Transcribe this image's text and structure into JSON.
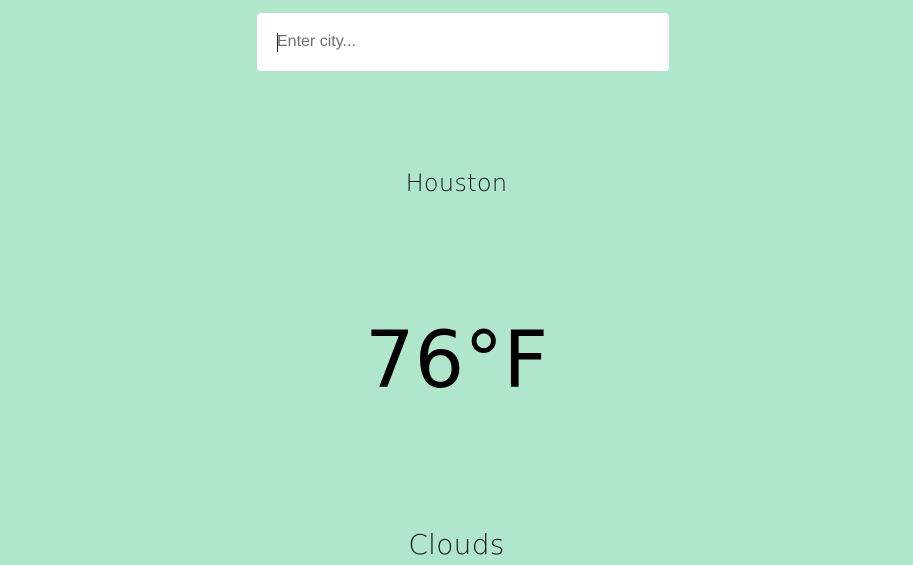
{
  "search": {
    "placeholder": "Enter city...",
    "value": ""
  },
  "weather": {
    "city": "Houston",
    "temperature": "76°F",
    "condition": "Clouds"
  },
  "colors": {
    "background": "#b0e6cb",
    "input_background": "#ffffff",
    "text": "#111111"
  }
}
